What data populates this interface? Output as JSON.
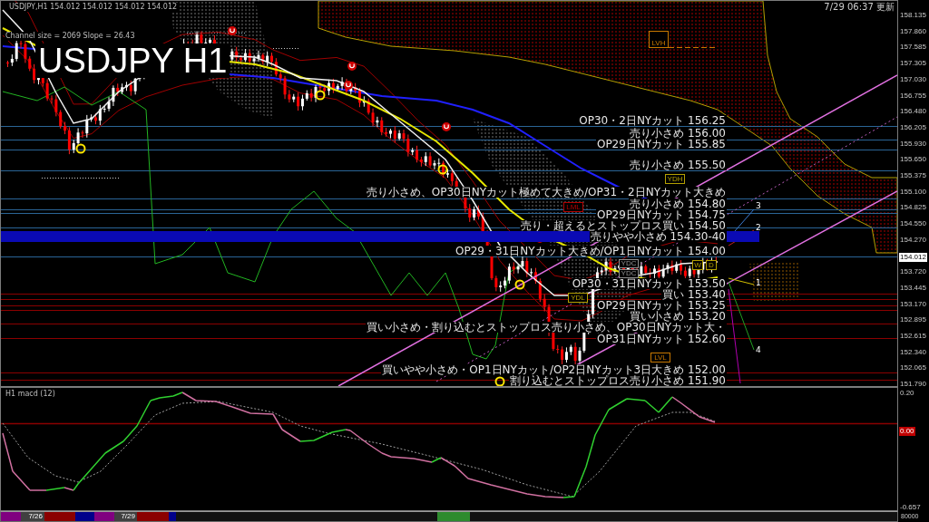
{
  "chart": {
    "header": "USDJPY,H1  154.012 154.012 154.012 154.012",
    "channel_info": "Channel size = 2069 Slope = 26.43",
    "title": "USDJPY H1",
    "updated": "7/29 06:37 更新"
  },
  "levels": [
    {
      "text": "OP30・2日NYカット 156.25",
      "kind": "resistance"
    },
    {
      "text": "売り小さめ 156.00",
      "kind": "resistance"
    },
    {
      "text": "OP29日NYカット 155.85",
      "kind": "resistance"
    },
    {
      "text": "売り小さめ 155.50",
      "kind": "resistance"
    },
    {
      "text": "売り小さめ、OP30日NYカット極めて大きめ/OP31・2日NYカット大きめ",
      "kind": "resistance"
    },
    {
      "text": "売り小さめ 154.80",
      "kind": "resistance"
    },
    {
      "text": "OP29日NYカット 154.75",
      "kind": "resistance"
    },
    {
      "text": "売り・超えるとストップロス買い 154.50",
      "kind": "resistance"
    },
    {
      "text": "売りやや小さめ 154.30-40",
      "kind": "band"
    },
    {
      "text": "OP29・31日NYカット大きめ/OP1日NYカット 154.00",
      "kind": "resistance"
    },
    {
      "text": "OP30・31日NYカット 153.50",
      "kind": "support"
    },
    {
      "text": "買い 153.40",
      "kind": "support"
    },
    {
      "text": "OP29日NYカット 153.25",
      "kind": "support"
    },
    {
      "text": "買い小さめ 153.20",
      "kind": "support"
    },
    {
      "text": "買い小さめ・割り込むとストップロス売り小さめ、OP30日NYカット大・",
      "kind": "support"
    },
    {
      "text": "OP31日NYカット 152.60",
      "kind": "support"
    },
    {
      "text": "買いやや小さめ・OP1日NYカット/OP2日NYカット3日大きめ 152.00",
      "kind": "support"
    },
    {
      "text": "割り込むとストップロス売り小さめ 151.90",
      "kind": "support"
    }
  ],
  "tags": [
    {
      "text": "LVH",
      "color": "#c87800"
    },
    {
      "text": "YDH",
      "color": "#b4a000"
    },
    {
      "text": "LML",
      "color": "#b40000"
    },
    {
      "text": "YDC",
      "color": "#909090"
    },
    {
      "text": "YDC",
      "color": "#909090"
    },
    {
      "text": "W",
      "color": "#b4a000"
    },
    {
      "text": "D",
      "color": "#b4a000"
    },
    {
      "text": "YDL",
      "color": "#b4a000"
    },
    {
      "text": "LVL",
      "color": "#c87800"
    }
  ],
  "wave_labels": [
    "3",
    "2",
    "1",
    "4"
  ],
  "price_axis": {
    "labels": [
      "158.135",
      "157.860",
      "157.585",
      "157.305",
      "157.030",
      "156.755",
      "156.480",
      "156.205",
      "155.930",
      "155.650",
      "155.375",
      "155.100",
      "154.825",
      "154.550",
      "154.270",
      "153.720",
      "153.445",
      "153.170",
      "152.895",
      "152.615",
      "152.340",
      "152.065",
      "151.790"
    ],
    "current": "154.012"
  },
  "indicator": {
    "title": "H1 macd (12)",
    "axis_labels": [
      {
        "text": "0.20",
        "kind": "plain"
      },
      {
        "text": "0.00",
        "kind": "marker"
      },
      {
        "text": "-0.657",
        "kind": "plain"
      }
    ]
  },
  "timeline": {
    "segments": [
      {
        "color": "#800080"
      },
      {
        "color": "#404040",
        "label": "7/26"
      },
      {
        "color": "#8b0000"
      },
      {
        "color": "#00008b"
      },
      {
        "color": "#800080"
      },
      {
        "color": "#404040",
        "label": "7/29"
      },
      {
        "color": "#8b0000"
      },
      {
        "color": "#00008b"
      },
      {
        "color": "#2e8b2e"
      }
    ],
    "axis_label": "80000"
  }
}
